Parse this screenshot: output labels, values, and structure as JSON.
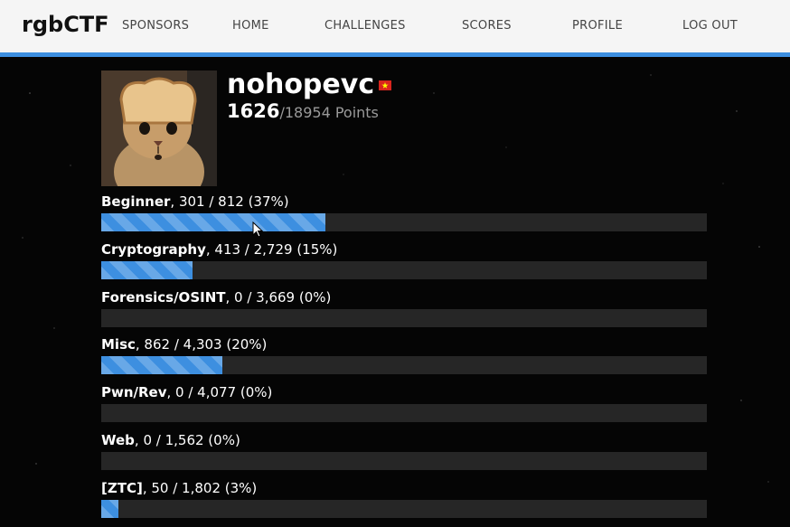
{
  "navbar": {
    "brand": "rgbCTF",
    "links": [
      "SPONSORS",
      "HOME",
      "CHALLENGES",
      "SCORES",
      "PROFILE",
      "LOG OUT"
    ],
    "accent_color": "#3d8fe0"
  },
  "profile": {
    "username": "nohopevc",
    "flag_icon": "vietnam-flag-icon",
    "score": "1626",
    "total": "/18954 Points"
  },
  "categories": [
    {
      "name": "Beginner",
      "stats": ", 301 / 812 (37%)",
      "fraction": 0.37
    },
    {
      "name": "Cryptography",
      "stats": ", 413 / 2,729 (15%)",
      "fraction": 0.15
    },
    {
      "name": "Forensics/OSINT",
      "stats": ", 0 / 3,669 (0%)",
      "fraction": 0.0
    },
    {
      "name": "Misc",
      "stats": ", 862 / 4,303 (20%)",
      "fraction": 0.2
    },
    {
      "name": "Pwn/Rev",
      "stats": ", 0 / 4,077 (0%)",
      "fraction": 0.0
    },
    {
      "name": "Web",
      "stats": ", 0 / 1,562 (0%)",
      "fraction": 0.0
    },
    {
      "name": "[ZTC]",
      "stats": ", 50 / 1,802 (3%)",
      "fraction": 0.028
    }
  ]
}
